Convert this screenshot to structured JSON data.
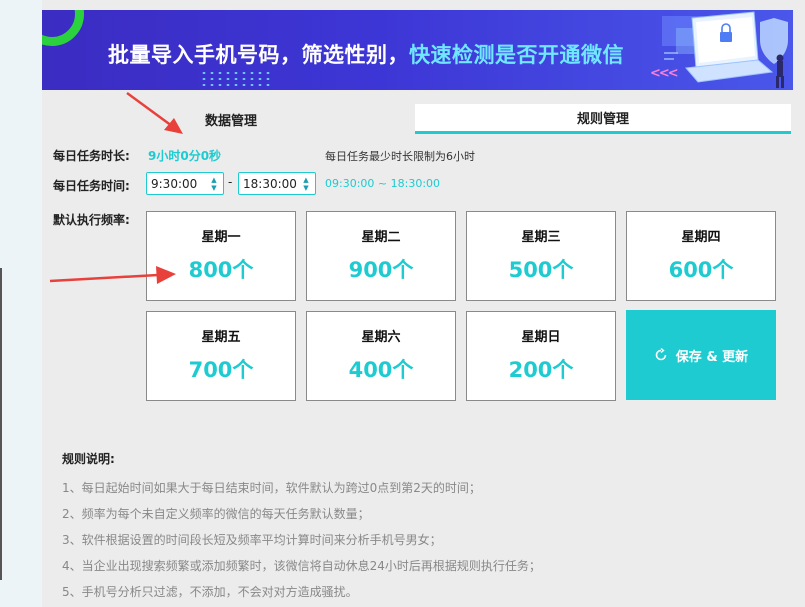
{
  "banner": {
    "title_part1": "批量导入手机号码，筛选性别，",
    "title_part2": "快速检测是否开通微信"
  },
  "tabs": [
    {
      "label": "数据管理",
      "active": false
    },
    {
      "label": "规则管理",
      "active": true
    }
  ],
  "settings": {
    "duration_label": "每日任务时长:",
    "duration_value": "9小时0分0秒",
    "duration_hint": "每日任务最少时长限制为6小时",
    "time_label": "每日任务时间:",
    "start_time": "9:30:00",
    "end_time": "18:30:00",
    "separator": "-",
    "time_range": "09:30:00 ~ 18:30:00",
    "freq_label": "默认执行频率:"
  },
  "days": [
    {
      "name": "星期一",
      "count": "800个"
    },
    {
      "name": "星期二",
      "count": "900个"
    },
    {
      "name": "星期三",
      "count": "500个"
    },
    {
      "name": "星期四",
      "count": "600个"
    },
    {
      "name": "星期五",
      "count": "700个"
    },
    {
      "name": "星期六",
      "count": "400个"
    },
    {
      "name": "星期日",
      "count": "200个"
    }
  ],
  "save_button": {
    "label": "保存 & 更新"
  },
  "rules": {
    "title": "规则说明:",
    "items": [
      "1、每日起始时间如果大于每日结束时间，软件默认为跨过0点到第2天的时间；",
      "2、频率为每个未自定义频率的微信的每天任务默认数量；",
      "3、软件根据设置的时间段长短及频率平均计算时间来分析手机号男女；",
      "4、当企业出现搜索频繁或添加频繁时，该微信将自动休息24小时后再根据规则执行任务；",
      "5、手机号分析只过滤，不添加，不会对对方造成骚扰。"
    ]
  },
  "colors": {
    "accent": "#1ecbd1",
    "annotation_arrow": "#e8413c",
    "banner_bg": "#3d36d6"
  }
}
